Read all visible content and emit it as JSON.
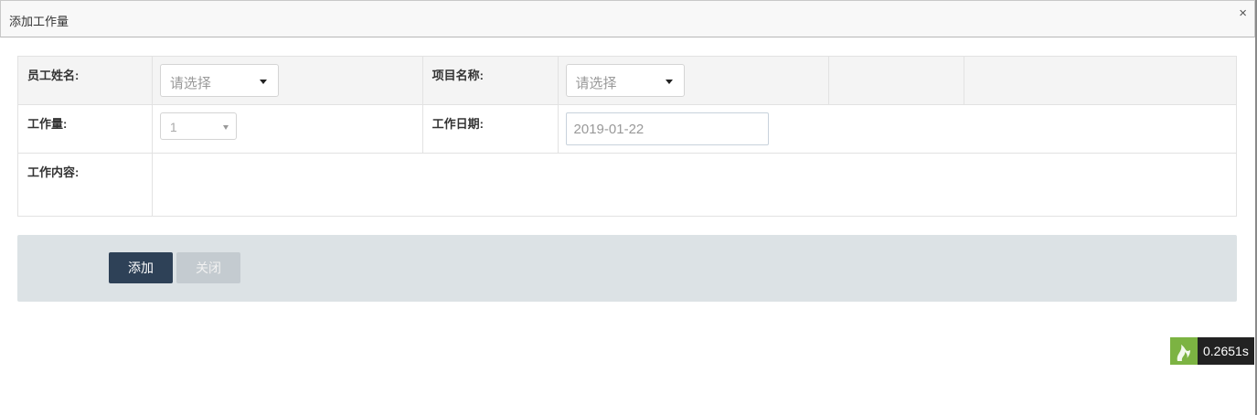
{
  "dialog": {
    "title": "添加工作量",
    "close_glyph": "×"
  },
  "form": {
    "employee_label": "员工姓名:",
    "employee_placeholder": "请选择",
    "project_label": "项目名称:",
    "project_placeholder": "请选择",
    "workload_label": "工作量:",
    "workload_value": "1",
    "work_date_label": "工作日期:",
    "work_date_value": "2019-01-22",
    "content_label": "工作内容:"
  },
  "footer": {
    "add_label": "添加",
    "close_label": "关闭"
  },
  "perf_badge": {
    "icon": "flame-logo-icon",
    "text": "0.2651s",
    "color": "#7cb342"
  },
  "colors": {
    "primary_button": "#2e4157",
    "disabled_button": "#c4cbd0",
    "footer_bg": "#dce2e5"
  }
}
